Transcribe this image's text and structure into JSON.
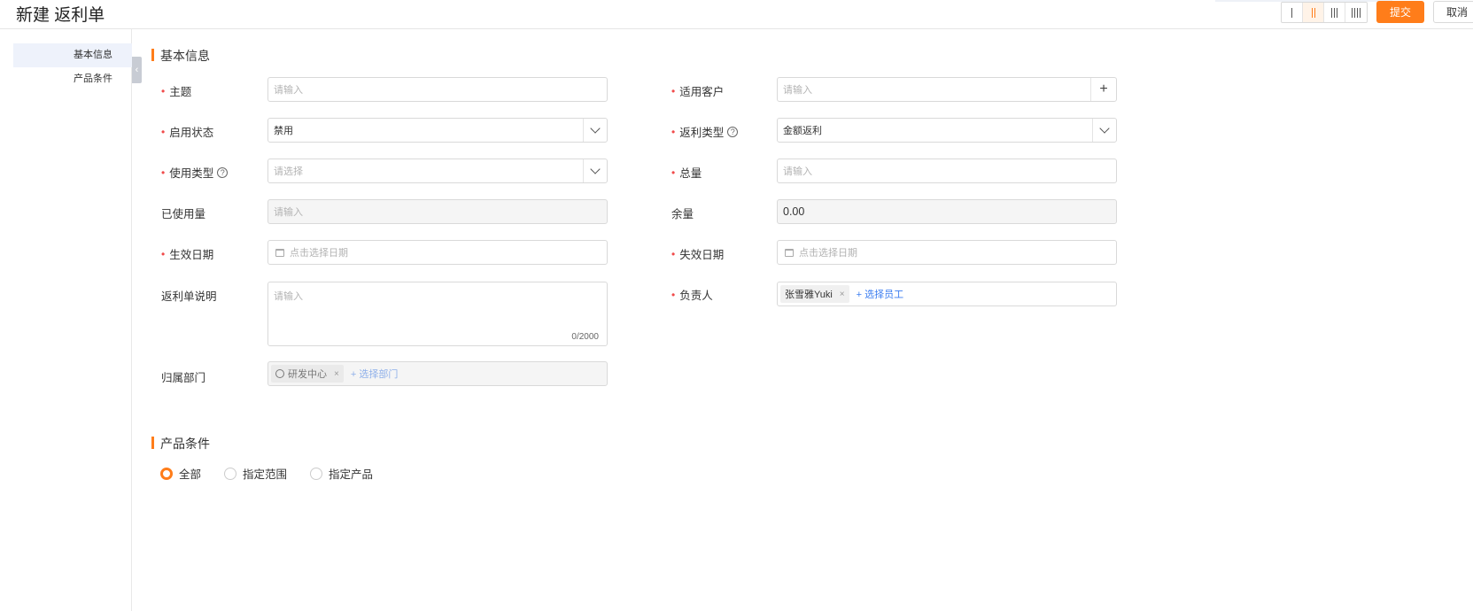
{
  "header": {
    "title": "新建 返利单",
    "submit_label": "提交",
    "cancel_label": "取消"
  },
  "layout_options": [
    {
      "name": "single-column",
      "active": false
    },
    {
      "name": "two-column",
      "active": true
    },
    {
      "name": "three-column",
      "active": false
    },
    {
      "name": "four-column",
      "active": false
    }
  ],
  "sidebar": {
    "items": [
      {
        "label": "基本信息",
        "active": true
      },
      {
        "label": "产品条件",
        "active": false
      }
    ]
  },
  "sections": {
    "basic": "基本信息",
    "product": "产品条件"
  },
  "form": {
    "subject": {
      "label": "主题",
      "placeholder": "请输入"
    },
    "customer": {
      "label": "适用客户",
      "placeholder": "请输入"
    },
    "status": {
      "label": "启用状态",
      "value": "禁用"
    },
    "rebate_type": {
      "label": "返利类型",
      "value": "金额返利"
    },
    "usage_type": {
      "label": "使用类型",
      "placeholder": "请选择"
    },
    "total": {
      "label": "总量",
      "placeholder": "请输入"
    },
    "used": {
      "label": "已使用量",
      "placeholder": "请输入"
    },
    "remaining": {
      "label": "余量",
      "value": "0.00"
    },
    "start_date": {
      "label": "生效日期",
      "placeholder": "点击选择日期"
    },
    "end_date": {
      "label": "失效日期",
      "placeholder": "点击选择日期"
    },
    "description": {
      "label": "返利单说明",
      "placeholder": "请输入",
      "counter": "0/2000"
    },
    "owner": {
      "label": "负责人",
      "tag": "张雪雅Yuki",
      "add_link": "+ 选择员工"
    },
    "department": {
      "label": "归属部门",
      "tag": "研发中心",
      "add_link": "+ 选择部门"
    }
  },
  "product_conditions": {
    "options": [
      "全部",
      "指定范围",
      "指定产品"
    ],
    "selected": "全部"
  },
  "colors": {
    "accent": "#ff7d1a",
    "required": "#f04a4a",
    "link": "#3c7ef0"
  }
}
